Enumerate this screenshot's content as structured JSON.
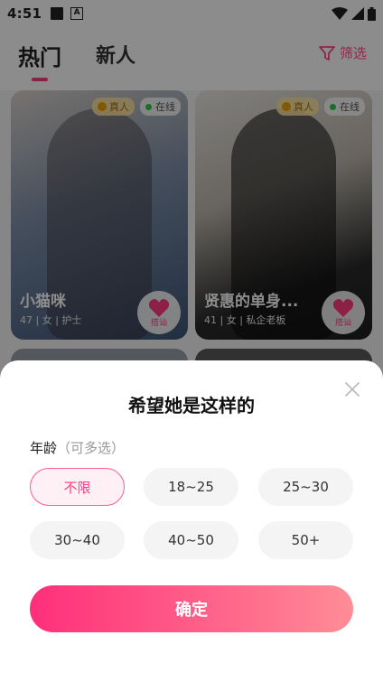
{
  "statusbar": {
    "time": "4:51"
  },
  "nav": {
    "tabs": [
      {
        "label": "热门",
        "active": true
      },
      {
        "label": "新人",
        "active": false
      }
    ],
    "filter_label": "筛选"
  },
  "feed": {
    "badge_real": "真人",
    "badge_online": "在线",
    "greet_label": "搭讪",
    "cards": [
      {
        "name": "小猫咪",
        "meta": "47 | 女 | 护士"
      },
      {
        "name": "贤惠的单身...",
        "meta": "41 | 女 | 私企老板"
      }
    ]
  },
  "sheet": {
    "title": "希望她是这样的",
    "section_label": "年龄",
    "section_hint": "（可多选）",
    "age_options": [
      {
        "label": "不限",
        "selected": true
      },
      {
        "label": "18~25",
        "selected": false
      },
      {
        "label": "25~30",
        "selected": false
      },
      {
        "label": "30~40",
        "selected": false
      },
      {
        "label": "40~50",
        "selected": false
      },
      {
        "label": "50+",
        "selected": false
      }
    ],
    "confirm_label": "确定"
  },
  "colors": {
    "accent": "#ff3d7f",
    "selected_bg": "#fff0f5",
    "option_bg": "#f4f4f4"
  }
}
